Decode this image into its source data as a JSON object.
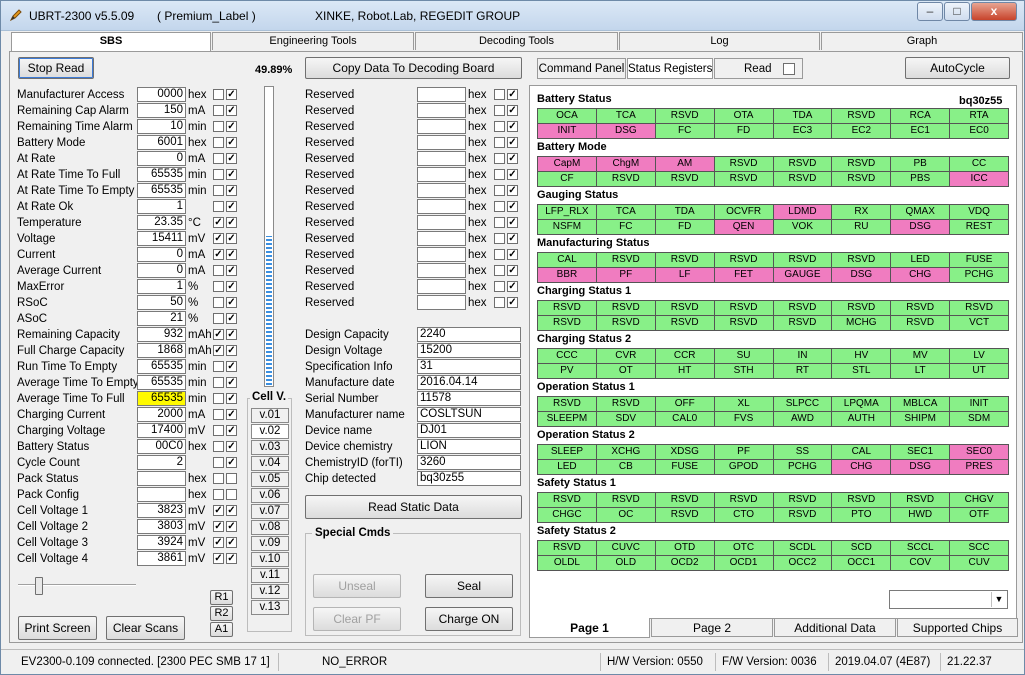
{
  "window": {
    "app_name": "UBRT-2300 v5.5.09",
    "label": "( Premium_Label )",
    "group": "XINKE,  Robot.Lab,  REGEDIT GROUP",
    "controls": {
      "minimize": "–",
      "maximize": "□",
      "close": "x"
    }
  },
  "tabs": [
    "SBS",
    "Engineering Tools",
    "Decoding Tools",
    "Log",
    "Graph"
  ],
  "left": {
    "stop_read": "Stop Read",
    "percent": "49.89%",
    "copy_button": "Copy Data To Decoding Board",
    "fields": [
      {
        "label": "Manufacturer Access",
        "value": "0000",
        "unit": "hex",
        "c1": "",
        "c2": "✓"
      },
      {
        "label": "Remaining Cap Alarm",
        "value": "150",
        "unit": "mA",
        "c1": "",
        "c2": "✓"
      },
      {
        "label": "Remaining Time Alarm",
        "value": "10",
        "unit": "min",
        "c1": "",
        "c2": "✓"
      },
      {
        "label": "Battery Mode",
        "value": "6001",
        "unit": "hex",
        "c1": "",
        "c2": "✓"
      },
      {
        "label": "At Rate",
        "value": "0",
        "unit": "mA",
        "c1": "",
        "c2": "✓"
      },
      {
        "label": "At Rate Time To Full",
        "value": "65535",
        "unit": "min",
        "c1": "",
        "c2": "✓"
      },
      {
        "label": "At Rate Time To Empty",
        "value": "65535",
        "unit": "min",
        "c1": "",
        "c2": "✓"
      },
      {
        "label": "At Rate Ok",
        "value": "1",
        "unit": "",
        "c1": "",
        "c2": "✓"
      },
      {
        "label": "Temperature",
        "value": "23.35",
        "unit": "°C",
        "c1": "✓",
        "c2": "✓"
      },
      {
        "label": "Voltage",
        "value": "15411",
        "unit": "mV",
        "c1": "✓",
        "c2": "✓"
      },
      {
        "label": "Current",
        "value": "0",
        "unit": "mA",
        "c1": "✓",
        "c2": "✓"
      },
      {
        "label": "Average Current",
        "value": "0",
        "unit": "mA",
        "c1": "",
        "c2": "✓"
      },
      {
        "label": "MaxError",
        "value": "1",
        "unit": "%",
        "c1": "",
        "c2": "✓"
      },
      {
        "label": "RSoC",
        "value": "50",
        "unit": "%",
        "c1": "",
        "c2": "✓"
      },
      {
        "label": "ASoC",
        "value": "21",
        "unit": "%",
        "c1": "",
        "c2": "✓"
      },
      {
        "label": "Remaining Capacity",
        "value": "932",
        "unit": "mAh",
        "c1": "✓",
        "c2": "✓"
      },
      {
        "label": "Full Charge Capacity",
        "value": "1868",
        "unit": "mAh",
        "c1": "✓",
        "c2": "✓"
      },
      {
        "label": "Run Time To Empty",
        "value": "65535",
        "unit": "min",
        "c1": "",
        "c2": "✓"
      },
      {
        "label": "Average Time To Empty",
        "value": "65535",
        "unit": "min",
        "c1": "",
        "c2": "✓"
      },
      {
        "label": "Average Time To Full",
        "value": "65535",
        "unit": "min",
        "c1": "",
        "c2": "✓",
        "highlight": true
      },
      {
        "label": "Charging Current",
        "value": "2000",
        "unit": "mA",
        "c1": "",
        "c2": "✓"
      },
      {
        "label": "Charging Voltage",
        "value": "17400",
        "unit": "mV",
        "c1": "",
        "c2": "✓"
      },
      {
        "label": "Battery Status",
        "value": "00C0",
        "unit": "hex",
        "c1": "",
        "c2": "✓"
      },
      {
        "label": "Cycle Count",
        "value": "2",
        "unit": "",
        "c1": "",
        "c2": "✓"
      },
      {
        "label": "Pack Status",
        "value": "",
        "unit": "hex",
        "c1": "",
        "c2": ""
      },
      {
        "label": "Pack Config",
        "value": "",
        "unit": "hex",
        "c1": "",
        "c2": ""
      },
      {
        "label": "Cell Voltage 1",
        "value": "3823",
        "unit": "mV",
        "c1": "✓",
        "c2": "✓"
      },
      {
        "label": "Cell Voltage 2",
        "value": "3803",
        "unit": "mV",
        "c1": "✓",
        "c2": "✓"
      },
      {
        "label": "Cell Voltage 3",
        "value": "3924",
        "unit": "mV",
        "c1": "✓",
        "c2": "✓"
      },
      {
        "label": "Cell Voltage 4",
        "value": "3861",
        "unit": "mV",
        "c1": "✓",
        "c2": "✓"
      }
    ],
    "reserved": {
      "label": "Reserved",
      "unit": "hex",
      "count": 14
    },
    "static": [
      {
        "label": "Design Capacity",
        "value": "2240"
      },
      {
        "label": "Design Voltage",
        "value": "15200"
      },
      {
        "label": "Specification Info",
        "value": "31"
      },
      {
        "label": "Manufacture date",
        "value": "2016.04.14"
      },
      {
        "label": "Serial Number",
        "value": "11578"
      },
      {
        "label": "Manufacturer name",
        "value": "COSLTSUN"
      },
      {
        "label": "Device name",
        "value": "DJ01"
      },
      {
        "label": "Device chemistry",
        "value": "LION"
      },
      {
        "label": "ChemistryID (forTI)",
        "value": "3260"
      },
      {
        "label": "Chip detected",
        "value": "bq30z55"
      }
    ],
    "read_static": "Read Static Data",
    "special_title": "Special Cmds",
    "unseal": "Unseal",
    "seal": "Seal",
    "clear_pf": "Clear PF",
    "charge_on": "Charge ON",
    "cell_title": "Cell V.",
    "cells": [
      "v.01",
      "v.02",
      "v.03",
      "v.04",
      "v.05",
      "v.06",
      "v.07",
      "v.08",
      "v.09",
      "v.10",
      "v.11",
      "v.12",
      "v.13"
    ],
    "r1": "R1",
    "r2": "R2",
    "a1": "A1",
    "print_screen": "Print Screen",
    "clear_scans": "Clear Scans",
    "progress_fraction": 0.4989
  },
  "right": {
    "command_panel": "Command Panel",
    "status_registers": "Status Registers",
    "read_label": "Read",
    "autocycle": "AutoCycle",
    "chip": "bq30z55",
    "groups": [
      {
        "title": "Battery Status",
        "rows": [
          [
            [
              "OCA",
              0
            ],
            [
              "TCA",
              0
            ],
            [
              "RSVD",
              0
            ],
            [
              "OTA",
              0
            ],
            [
              "TDA",
              0
            ],
            [
              "RSVD",
              0
            ],
            [
              "RCA",
              0
            ],
            [
              "RTA",
              0
            ]
          ],
          [
            [
              "INIT",
              1
            ],
            [
              "DSG",
              1
            ],
            [
              "FC",
              0
            ],
            [
              "FD",
              0
            ],
            [
              "EC3",
              0
            ],
            [
              "EC2",
              0
            ],
            [
              "EC1",
              0
            ],
            [
              "EC0",
              0
            ]
          ]
        ]
      },
      {
        "title": "Battery Mode",
        "rows": [
          [
            [
              "CapM",
              1
            ],
            [
              "ChgM",
              1
            ],
            [
              "AM",
              1
            ],
            [
              "RSVD",
              0
            ],
            [
              "RSVD",
              0
            ],
            [
              "RSVD",
              0
            ],
            [
              "PB",
              0
            ],
            [
              "CC",
              0
            ]
          ],
          [
            [
              "CF",
              0
            ],
            [
              "RSVD",
              0
            ],
            [
              "RSVD",
              0
            ],
            [
              "RSVD",
              0
            ],
            [
              "RSVD",
              0
            ],
            [
              "RSVD",
              0
            ],
            [
              "PBS",
              0
            ],
            [
              "ICC",
              1
            ]
          ]
        ]
      },
      {
        "title": "Gauging Status",
        "rows": [
          [
            [
              "LFP_RLX",
              0
            ],
            [
              "TCA",
              0
            ],
            [
              "TDA",
              0
            ],
            [
              "OCVFR",
              0
            ],
            [
              "LDMD",
              1
            ],
            [
              "RX",
              0
            ],
            [
              "QMAX",
              0
            ],
            [
              "VDQ",
              0
            ]
          ],
          [
            [
              "NSFM",
              0
            ],
            [
              "FC",
              0
            ],
            [
              "FD",
              0
            ],
            [
              "QEN",
              1
            ],
            [
              "VOK",
              0
            ],
            [
              "RU",
              0
            ],
            [
              "DSG",
              1
            ],
            [
              "REST",
              0
            ]
          ]
        ]
      },
      {
        "title": "Manufacturing Status",
        "rows": [
          [
            [
              "CAL",
              0
            ],
            [
              "RSVD",
              0
            ],
            [
              "RSVD",
              0
            ],
            [
              "RSVD",
              0
            ],
            [
              "RSVD",
              0
            ],
            [
              "RSVD",
              0
            ],
            [
              "LED",
              0
            ],
            [
              "FUSE",
              0
            ]
          ],
          [
            [
              "BBR",
              1
            ],
            [
              "PF",
              1
            ],
            [
              "LF",
              1
            ],
            [
              "FET",
              1
            ],
            [
              "GAUGE",
              1
            ],
            [
              "DSG",
              1
            ],
            [
              "CHG",
              1
            ],
            [
              "PCHG",
              0
            ]
          ]
        ]
      },
      {
        "title": "Charging Status 1",
        "rows": [
          [
            [
              "RSVD",
              0
            ],
            [
              "RSVD",
              0
            ],
            [
              "RSVD",
              0
            ],
            [
              "RSVD",
              0
            ],
            [
              "RSVD",
              0
            ],
            [
              "RSVD",
              0
            ],
            [
              "RSVD",
              0
            ],
            [
              "RSVD",
              0
            ]
          ],
          [
            [
              "RSVD",
              0
            ],
            [
              "RSVD",
              0
            ],
            [
              "RSVD",
              0
            ],
            [
              "RSVD",
              0
            ],
            [
              "RSVD",
              0
            ],
            [
              "MCHG",
              0
            ],
            [
              "RSVD",
              0
            ],
            [
              "VCT",
              0
            ]
          ]
        ]
      },
      {
        "title": "Charging Status 2",
        "rows": [
          [
            [
              "CCC",
              0
            ],
            [
              "CVR",
              0
            ],
            [
              "CCR",
              0
            ],
            [
              "SU",
              0
            ],
            [
              "IN",
              0
            ],
            [
              "HV",
              0
            ],
            [
              "MV",
              0
            ],
            [
              "LV",
              0
            ]
          ],
          [
            [
              "PV",
              0
            ],
            [
              "OT",
              0
            ],
            [
              "HT",
              0
            ],
            [
              "STH",
              0
            ],
            [
              "RT",
              0
            ],
            [
              "STL",
              0
            ],
            [
              "LT",
              0
            ],
            [
              "UT",
              0
            ]
          ]
        ]
      },
      {
        "title": "Operation Status 1",
        "rows": [
          [
            [
              "RSVD",
              0
            ],
            [
              "RSVD",
              0
            ],
            [
              "OFF",
              0
            ],
            [
              "XL",
              0
            ],
            [
              "SLPCC",
              0
            ],
            [
              "LPQMA",
              0
            ],
            [
              "MBLCA",
              0
            ],
            [
              "INIT",
              0
            ]
          ],
          [
            [
              "SLEEPM",
              0
            ],
            [
              "SDV",
              0
            ],
            [
              "CAL0",
              0
            ],
            [
              "FVS",
              0
            ],
            [
              "AWD",
              0
            ],
            [
              "AUTH",
              0
            ],
            [
              "SHIPM",
              0
            ],
            [
              "SDM",
              0
            ]
          ]
        ]
      },
      {
        "title": "Operation Status 2",
        "rows": [
          [
            [
              "SLEEP",
              0
            ],
            [
              "XCHG",
              0
            ],
            [
              "XDSG",
              0
            ],
            [
              "PF",
              0
            ],
            [
              "SS",
              0
            ],
            [
              "CAL",
              0
            ],
            [
              "SEC1",
              0
            ],
            [
              "SEC0",
              1
            ]
          ],
          [
            [
              "LED",
              0
            ],
            [
              "CB",
              0
            ],
            [
              "FUSE",
              0
            ],
            [
              "GPOD",
              0
            ],
            [
              "PCHG",
              0
            ],
            [
              "CHG",
              1
            ],
            [
              "DSG",
              1
            ],
            [
              "PRES",
              1
            ]
          ]
        ]
      },
      {
        "title": "Safety Status 1",
        "rows": [
          [
            [
              "RSVD",
              0
            ],
            [
              "RSVD",
              0
            ],
            [
              "RSVD",
              0
            ],
            [
              "RSVD",
              0
            ],
            [
              "RSVD",
              0
            ],
            [
              "RSVD",
              0
            ],
            [
              "RSVD",
              0
            ],
            [
              "CHGV",
              0
            ]
          ],
          [
            [
              "CHGC",
              0
            ],
            [
              "OC",
              0
            ],
            [
              "RSVD",
              0
            ],
            [
              "CTO",
              0
            ],
            [
              "RSVD",
              0
            ],
            [
              "PTO",
              0
            ],
            [
              "HWD",
              0
            ],
            [
              "OTF",
              0
            ]
          ]
        ]
      },
      {
        "title": "Safety Status 2",
        "rows": [
          [
            [
              "RSVD",
              0
            ],
            [
              "CUVC",
              0
            ],
            [
              "OTD",
              0
            ],
            [
              "OTC",
              0
            ],
            [
              "SCDL",
              0
            ],
            [
              "SCD",
              0
            ],
            [
              "SCCL",
              0
            ],
            [
              "SCC",
              0
            ]
          ],
          [
            [
              "OLDL",
              0
            ],
            [
              "OLD",
              0
            ],
            [
              "OCD2",
              0
            ],
            [
              "OCD1",
              0
            ],
            [
              "OCC2",
              0
            ],
            [
              "OCC1",
              0
            ],
            [
              "COV",
              0
            ],
            [
              "CUV",
              0
            ]
          ]
        ]
      }
    ],
    "pages": [
      "Page 1",
      "Page 2",
      "Additional Data",
      "Supported Chips"
    ],
    "dropdown_value": ""
  },
  "status": {
    "connection": "EV2300-0.109 connected. [2300  PEC  SMB  17 1]",
    "error": "NO_ERROR",
    "hw": "H/W Version: 0550",
    "fw": "F/W Version: 0036",
    "date": "2019.04.07  (4E87)",
    "time": "21.22.37"
  },
  "colors": {
    "reg_off": "#88f088",
    "reg_on": "#f07cc0",
    "highlight": "#fffa00",
    "gauge": "#3b8fe0"
  }
}
